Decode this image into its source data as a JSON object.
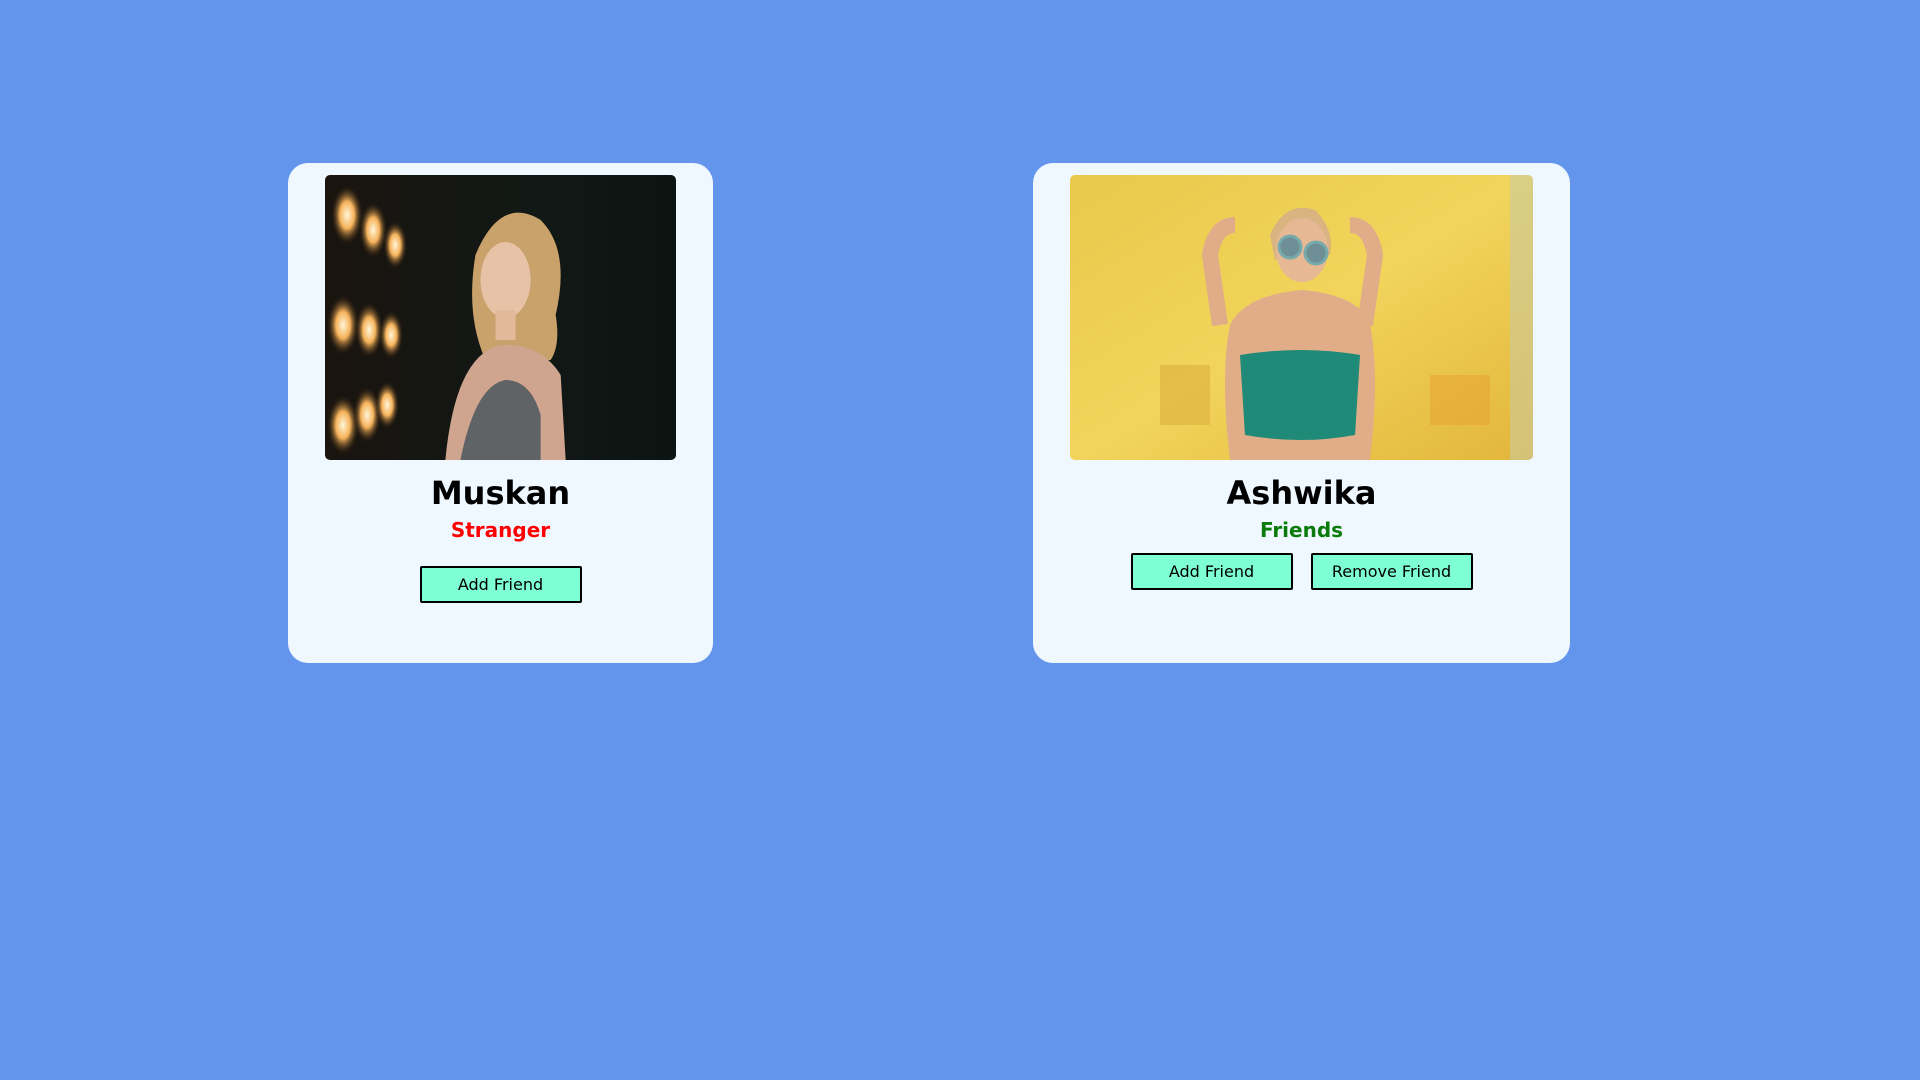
{
  "cards": [
    {
      "name": "Muskan",
      "status": "Stranger",
      "status_color": "#ff0000",
      "buttons": {
        "add": "Add Friend"
      }
    },
    {
      "name": "Ashwika",
      "status": "Friends",
      "status_color": "#0a7a0a",
      "buttons": {
        "add": "Add Friend",
        "remove": "Remove Friend"
      }
    }
  ],
  "colors": {
    "background": "#6495ed",
    "card": "#f0f8ff",
    "button": "#7fffd4"
  }
}
